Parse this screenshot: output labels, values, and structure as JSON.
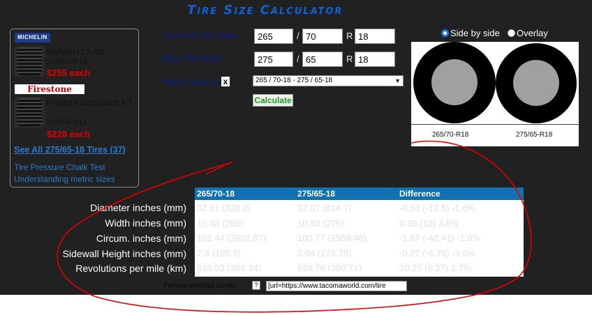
{
  "title": "Tire Size Calculator",
  "sidebar": {
    "tires": [
      {
        "brand": "MICHELIN",
        "name": "Michelin LTX A/S",
        "size": "275/65-R18",
        "price": "$255 each"
      },
      {
        "brand": "Firestone",
        "name": "Firestone Destination A/T",
        "size": "275/65-R18",
        "price": "$228 each"
      }
    ],
    "see_all": "See All 275/65-18 Tires (37)",
    "links": [
      "Tire Pressure Chalk Test",
      "Understanding metric sizes"
    ]
  },
  "form": {
    "current_label": "Current Tire Size:",
    "new_label": "New Tire Size:",
    "calcs_label": "Your Calcs (1):",
    "current": {
      "width": "265",
      "aspect": "70",
      "rim": "18"
    },
    "new": {
      "width": "275",
      "aspect": "65",
      "rim": "18"
    },
    "slash": "/",
    "r_label": "R",
    "calcs_selected": "265 / 70-18 - 275 / 65-18",
    "close_glyph": "x",
    "calculate": "Calculate"
  },
  "view": {
    "side_by_side": "Side by side",
    "overlay": "Overlay",
    "label_left": "265/70-R18",
    "label_right": "275/65-R18"
  },
  "table": {
    "headers": [
      "265/70-18",
      "275/65-18",
      "Difference"
    ],
    "rows": [
      {
        "label": "Diameter inches (mm)",
        "a": "32.61 (828.2)",
        "b": "32.07 (814.7)",
        "diff": "-0.53 (-13.5) -1.6%"
      },
      {
        "label": "Width inches (mm)",
        "a": "10.43 (265)",
        "b": "10.83 (275)",
        "diff": "0.39 (10) 3.8%"
      },
      {
        "label": "Circum. inches (mm)",
        "a": "102.44 (2601.87)",
        "b": "100.77 (2559.46)",
        "diff": "-1.67 (-42.41) -1.6%"
      },
      {
        "label": "Sidewall Height inches (mm)",
        "a": "7.3 (185.5)",
        "b": "7.04 (178.75)",
        "diff": "-0.27 (-6.75) -3.6%"
      },
      {
        "label": "Revolutions per mile (km)",
        "a": "618.53 (384.34)",
        "b": "628.78 (390.71)",
        "diff": "10.25 (6.37) 1.7%"
      }
    ]
  },
  "embed": {
    "label": "Forum embed code:",
    "help": "?",
    "value": "[url=https://www.tacomaworld.com/tire"
  },
  "colors": {
    "accent": "#1070b0",
    "price": "#e00000",
    "annotation": "#e00000"
  }
}
